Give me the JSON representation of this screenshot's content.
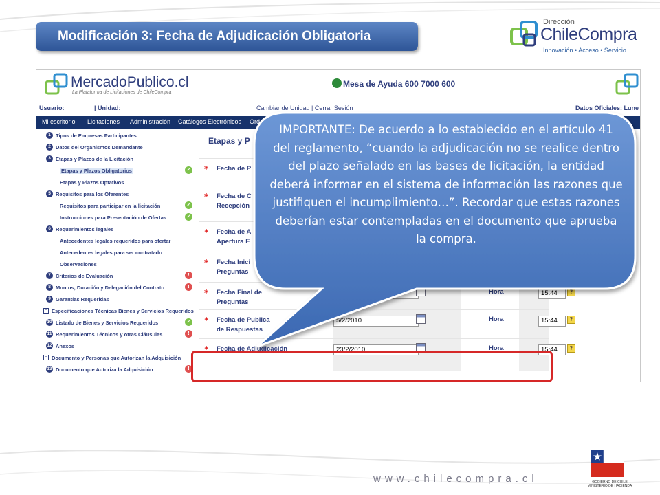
{
  "slide": {
    "title": "Modificación 3: Fecha de Adjudicación Obligatoria",
    "footer_url": "www.chilecompra.cl"
  },
  "logo": {
    "direccion": "Dirección",
    "brand": "ChileCompra",
    "tagline": "Innovación • Acceso • Servicio"
  },
  "gobierno": {
    "line1": "GOBIERNO DE CHILE",
    "line2": "MINISTERIO DE HACIENDA"
  },
  "mercadopublico": {
    "name": "MercadoPublico.cl",
    "subtitle": "La Plataforma de Licitaciones de ChileCompra",
    "help": "Mesa de Ayuda 600 7000 600",
    "user_label": "Usuario:",
    "unit_label": "| Unidad:",
    "links": "Cambiar de Unidad | Cerrar Sesión",
    "datos": "Datos Oficiales: Lune",
    "nav": [
      "Mi escritorio",
      "Licitaciones",
      "Administración",
      "Catálogos Electrónicos",
      "Ord"
    ]
  },
  "sidebar": [
    {
      "type": "num",
      "n": "1",
      "label": "Tipos de Empresas Participantes"
    },
    {
      "type": "num",
      "n": "2",
      "label": "Datos del Organismos Demandante"
    },
    {
      "type": "num",
      "n": "3",
      "label": "Etapas y Plazos de la Licitación"
    },
    {
      "type": "sub",
      "label": "Etapas y Plazos Obligatorios",
      "status": "ok",
      "selected": true
    },
    {
      "type": "sub",
      "label": "Etapas y Plazos Optativos"
    },
    {
      "type": "num",
      "n": "5",
      "label": "Requisitos para los Oferentes"
    },
    {
      "type": "sub",
      "label": "Requisitos para participar en la licitación",
      "status": "ok"
    },
    {
      "type": "sub",
      "label": "Instrucciones para Presentación de Ofertas",
      "status": "ok"
    },
    {
      "type": "num",
      "n": "6",
      "label": "Requerimientos legales"
    },
    {
      "type": "sub",
      "label": "Antecedentes legales requeridos para ofertar"
    },
    {
      "type": "sub",
      "label": "Antecedentes legales para ser contratado"
    },
    {
      "type": "sub",
      "label": "Observaciones"
    },
    {
      "type": "num",
      "n": "7",
      "label": "Criterios de Evaluación",
      "status": "err"
    },
    {
      "type": "num",
      "n": "8",
      "label": "Montos, Duración y Delegación del Contrato",
      "status": "err"
    },
    {
      "type": "num",
      "n": "9",
      "label": "Garantías Requeridas"
    },
    {
      "type": "box",
      "label": "Especificaciones Técnicas Bienes y Servicios Requeridos"
    },
    {
      "type": "num",
      "n": "10",
      "label": "Listado de Bienes y Servicios Requeridos",
      "status": "ok"
    },
    {
      "type": "num",
      "n": "11",
      "label": "Requerimientos Técnicos y otras Cláusulas",
      "status": "err"
    },
    {
      "type": "num",
      "n": "12",
      "label": "Anexos"
    },
    {
      "type": "box",
      "label": "Documento y Personas que Autorizan la Adquisición"
    },
    {
      "type": "num",
      "n": "13",
      "label": "Documento que Autoriza la Adquisición",
      "status": "err"
    }
  ],
  "content": {
    "title": "Etapas y P",
    "hora_label": "Hora",
    "rows": [
      {
        "label": "Fecha de P",
        "date": "",
        "time": ""
      },
      {
        "label": "Fecha de C\nRecepción",
        "date": "",
        "time": ""
      },
      {
        "label": "Fecha de A\nApertura E",
        "date": "",
        "time": ""
      },
      {
        "label": "Fecha Inici\nPreguntas",
        "date": "",
        "time": ""
      },
      {
        "label": "Fecha Final de\nPreguntas",
        "date": "",
        "time": "15:44"
      },
      {
        "label": "Fecha de Publica\nde Respuestas",
        "date": "5/2/2010",
        "time": "15:44"
      },
      {
        "label": "Fecha de Adjudicación",
        "date": "23/2/2010",
        "time": "15:44"
      }
    ]
  },
  "callout": {
    "text": "IMPORTANTE: De acuerdo a lo establecido en el artículo 41 del reglamento, “cuando la adjudicación no se realice dentro del plazo señalado en las bases de licitación, la entidad deberá informar en el sistema de información las razones que justifiquen el incumplimiento…”. Recordar que estas razones deberían estar contempladas en el documento que aprueba la compra."
  }
}
